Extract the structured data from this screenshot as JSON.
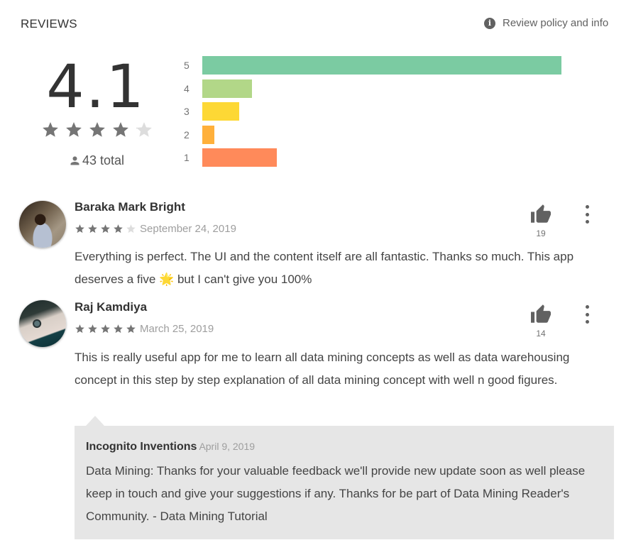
{
  "header": {
    "title": "REVIEWS",
    "policy_link": "Review policy and info",
    "policy_icon": "info-icon"
  },
  "summary": {
    "average": "4.1",
    "average_value": 4.1,
    "max_stars": 5,
    "total_label": "43 total",
    "total_icon": "person-icon"
  },
  "colors": {
    "star_filled": "#757575",
    "star_empty": "#dddddd",
    "bar_5": "#7bcba2",
    "bar_4": "#b2d788",
    "bar_3": "#fdd835",
    "bar_2": "#ffb03b",
    "bar_1": "#ff8a5a",
    "reply_bg": "#e6e6e6"
  },
  "chart_data": {
    "type": "bar",
    "orientation": "horizontal",
    "title": "",
    "categories": [
      "5",
      "4",
      "3",
      "2",
      "1"
    ],
    "values": [
      29,
      4,
      3,
      1,
      6
    ],
    "colors": [
      "#7bcba2",
      "#b2d788",
      "#fdd835",
      "#ffb03b",
      "#ff8a5a"
    ],
    "xlabel": "",
    "ylabel": "",
    "grid": false
  },
  "reviews": [
    {
      "author": "Baraka Mark Bright",
      "rating": 4,
      "date": "September 24, 2019",
      "text": "Everything is perfect. The UI and the content itself are all fantastic. Thanks so much. This app deserves a five 🌟 but I can't give you 100%",
      "likes": "19",
      "avatar_icon": "user-avatar"
    },
    {
      "author": "Raj Kamdiya",
      "rating": 5,
      "date": "March 25, 2019",
      "text": "This is really useful app for me to learn all data mining concepts as well as data warehousing concept in this step by step explanation of all data mining concept with well n good figures.",
      "likes": "14",
      "avatar_icon": "user-avatar",
      "reply": {
        "developer": "Incognito Inventions",
        "date": "April 9, 2019",
        "text": "Data Mining: Thanks for your valuable feedback we'll provide new update soon as well please keep in touch and give your suggestions if any. Thanks for be part of Data Mining Reader's Community. - Data Mining Tutorial"
      }
    }
  ]
}
